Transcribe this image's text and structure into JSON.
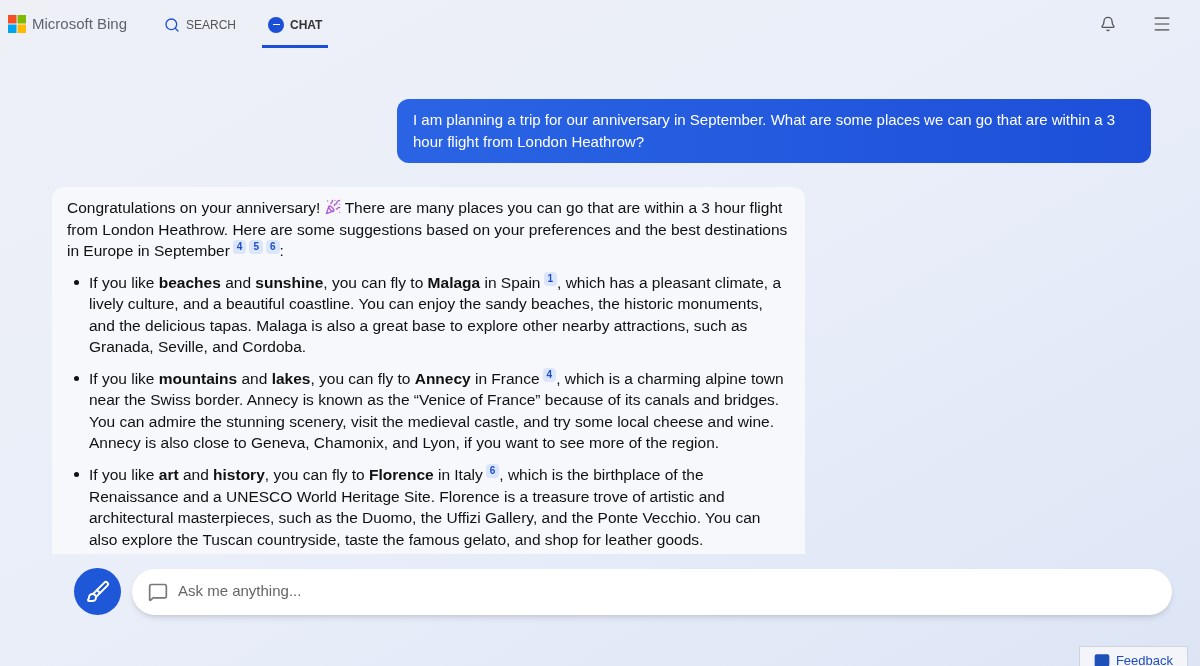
{
  "header": {
    "logo": "Microsoft Bing",
    "tabs": [
      {
        "label": "SEARCH",
        "kind": "search",
        "selected": false
      },
      {
        "label": "CHAT",
        "kind": "chat",
        "selected": true
      }
    ]
  },
  "user_message": "I am planning a trip for our anniversary in September. What are some places we can go that are within a 3 hour flight from London Heathrow?",
  "bot_message": {
    "intro": [
      {
        "kind": "text",
        "text": "Congratulations on your anniversary! "
      },
      {
        "kind": "emoji"
      },
      {
        "kind": "text",
        "text": " There are many places you can go that are within a 3 hour flight from London Heathrow. Here are some suggestions based on your preferences and the best destinations in Europe in September"
      },
      {
        "kind": "cite",
        "text": "4"
      },
      {
        "kind": "cite",
        "text": "5"
      },
      {
        "kind": "cite",
        "text": "6"
      },
      {
        "kind": "text",
        "text": ":"
      }
    ],
    "bullets": [
      [
        {
          "kind": "text",
          "text": "If you like **beaches** and **sunshine**, you can fly to **Malaga** in Spain"
        },
        {
          "kind": "cite",
          "text": "1"
        },
        {
          "kind": "text",
          "text": ", which has a pleasant climate, a lively culture, and a beautiful coastline. You can enjoy the sandy beaches, the historic monuments, and the delicious tapas. Malaga is also a great base to explore other nearby attractions, such as Granada, Seville, and Cordoba."
        }
      ],
      [
        {
          "kind": "text",
          "text": "If you like **mountains** and **lakes**, you can fly to **Annecy** in France"
        },
        {
          "kind": "cite",
          "text": "4"
        },
        {
          "kind": "text",
          "text": ", which is a charming alpine town near the Swiss border. Annecy is known as the “Venice of France” because of its canals and bridges. You can admire the stunning scenery, visit the medieval castle, and try some local cheese and wine. Annecy is also close to Geneva, Chamonix, and Lyon, if you want to see more of the region."
        }
      ],
      [
        {
          "kind": "text",
          "text": "If you like **art** and **history**, you can fly to **Florence** in Italy"
        },
        {
          "kind": "cite",
          "text": "6"
        },
        {
          "kind": "text",
          "text": ", which is the birthplace of the Renaissance and a UNESCO World Heritage Site. Florence is a treasure trove of artistic and architectural masterpieces, such as the Duomo, the Uffizi Gallery, and the Ponte Vecchio. You can also explore the Tuscan countryside, taste the famous gelato, and shop for leather goods."
        }
      ]
    ]
  },
  "input": {
    "placeholder": "Ask me anything..."
  },
  "feedback": "Feedback"
}
